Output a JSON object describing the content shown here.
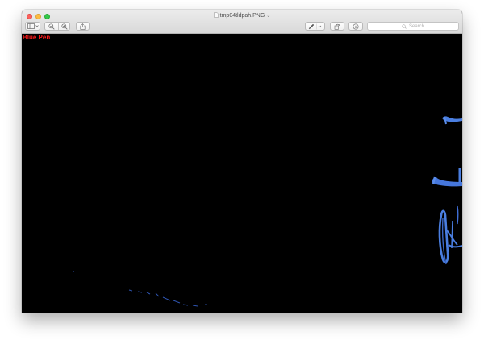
{
  "window": {
    "title": "tmp04tldpah.PNG"
  },
  "toolbar": {
    "sidebar_button": "sidebar-icon",
    "zoom_out_button": "zoom-out-icon",
    "zoom_in_button": "zoom-in-icon",
    "share_button": "share-icon",
    "markup_button": "pen-icon",
    "rotate_button": "rotate-icon",
    "annotate_button": "annotate-icon"
  },
  "search": {
    "placeholder": "Search"
  },
  "image": {
    "label": "Blue Pen",
    "label_color": "#ff1a1a",
    "background_color": "#000000",
    "stroke_color": "#3f6fd8"
  }
}
